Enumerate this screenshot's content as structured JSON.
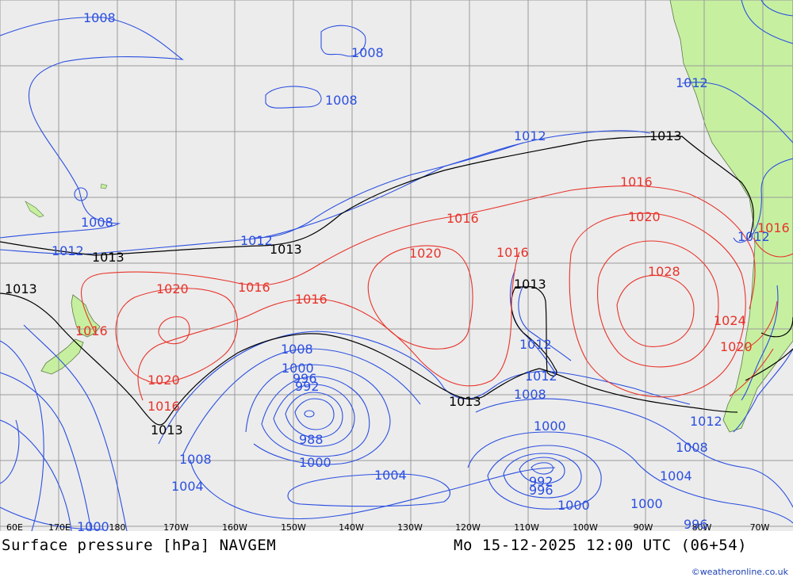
{
  "map": {
    "title": "Surface pressure [hPa] NAVGEM",
    "valid_time": "Mo 15-12-2025 12:00 UTC (06+54)",
    "credit": "©weatheronline.co.uk",
    "longitude_labels": [
      "60E",
      "170E",
      "180",
      "170W",
      "160W",
      "150W",
      "140W",
      "130W",
      "120W",
      "110W",
      "100W",
      "90W",
      "80W",
      "70W"
    ],
    "colors": {
      "ocean": "#ececec",
      "land": "#c6f0a0",
      "grid": "#9a9a9a",
      "low": "#2b4fe0",
      "mid": "#000000",
      "high": "#e8332a"
    },
    "isobar_labels": {
      "l1008a": "1008",
      "l1008b": "1008",
      "l1008c": "1008",
      "l1008d": "1008",
      "l1012a": "1012",
      "l1012b": "1012",
      "l1012c": "1012",
      "l1012d": "1012",
      "l1012e": "1012",
      "l1013a": "1013",
      "l1013b": "1013",
      "l1013c": "1013",
      "l1013d": "1013",
      "l1013e": "1013",
      "l1013f": "1013",
      "l1013g": "1013",
      "l1016a": "1016",
      "l1016b": "1016",
      "l1016c": "1016",
      "l1016d": "1016",
      "l1016e": "1016",
      "l1016f": "1016",
      "l1016g": "1016",
      "l1016h": "1016",
      "l1020a": "1020",
      "l1020b": "1020",
      "l1020c": "1020",
      "l1020d": "1020",
      "l1020e": "1020",
      "l1024": "1024",
      "l1028": "1028",
      "l1012f": "1012",
      "l1012g": "1012",
      "l1012h": "1012",
      "l1008e": "1008",
      "l1008f": "1008",
      "l1008g": "1008",
      "l1008h": "1008",
      "l1004a": "1004",
      "l1004b": "1004",
      "l1000a": "1000",
      "l1000b": "1000",
      "l1000c": "1000",
      "l1000d": "1000",
      "l1000e": "1000",
      "l1000f": "1000",
      "l996a": "996",
      "l996b": "996",
      "l996c": "996",
      "l992a": "992",
      "l992b": "992",
      "l988": "988",
      "l1004c": "1004"
    }
  }
}
